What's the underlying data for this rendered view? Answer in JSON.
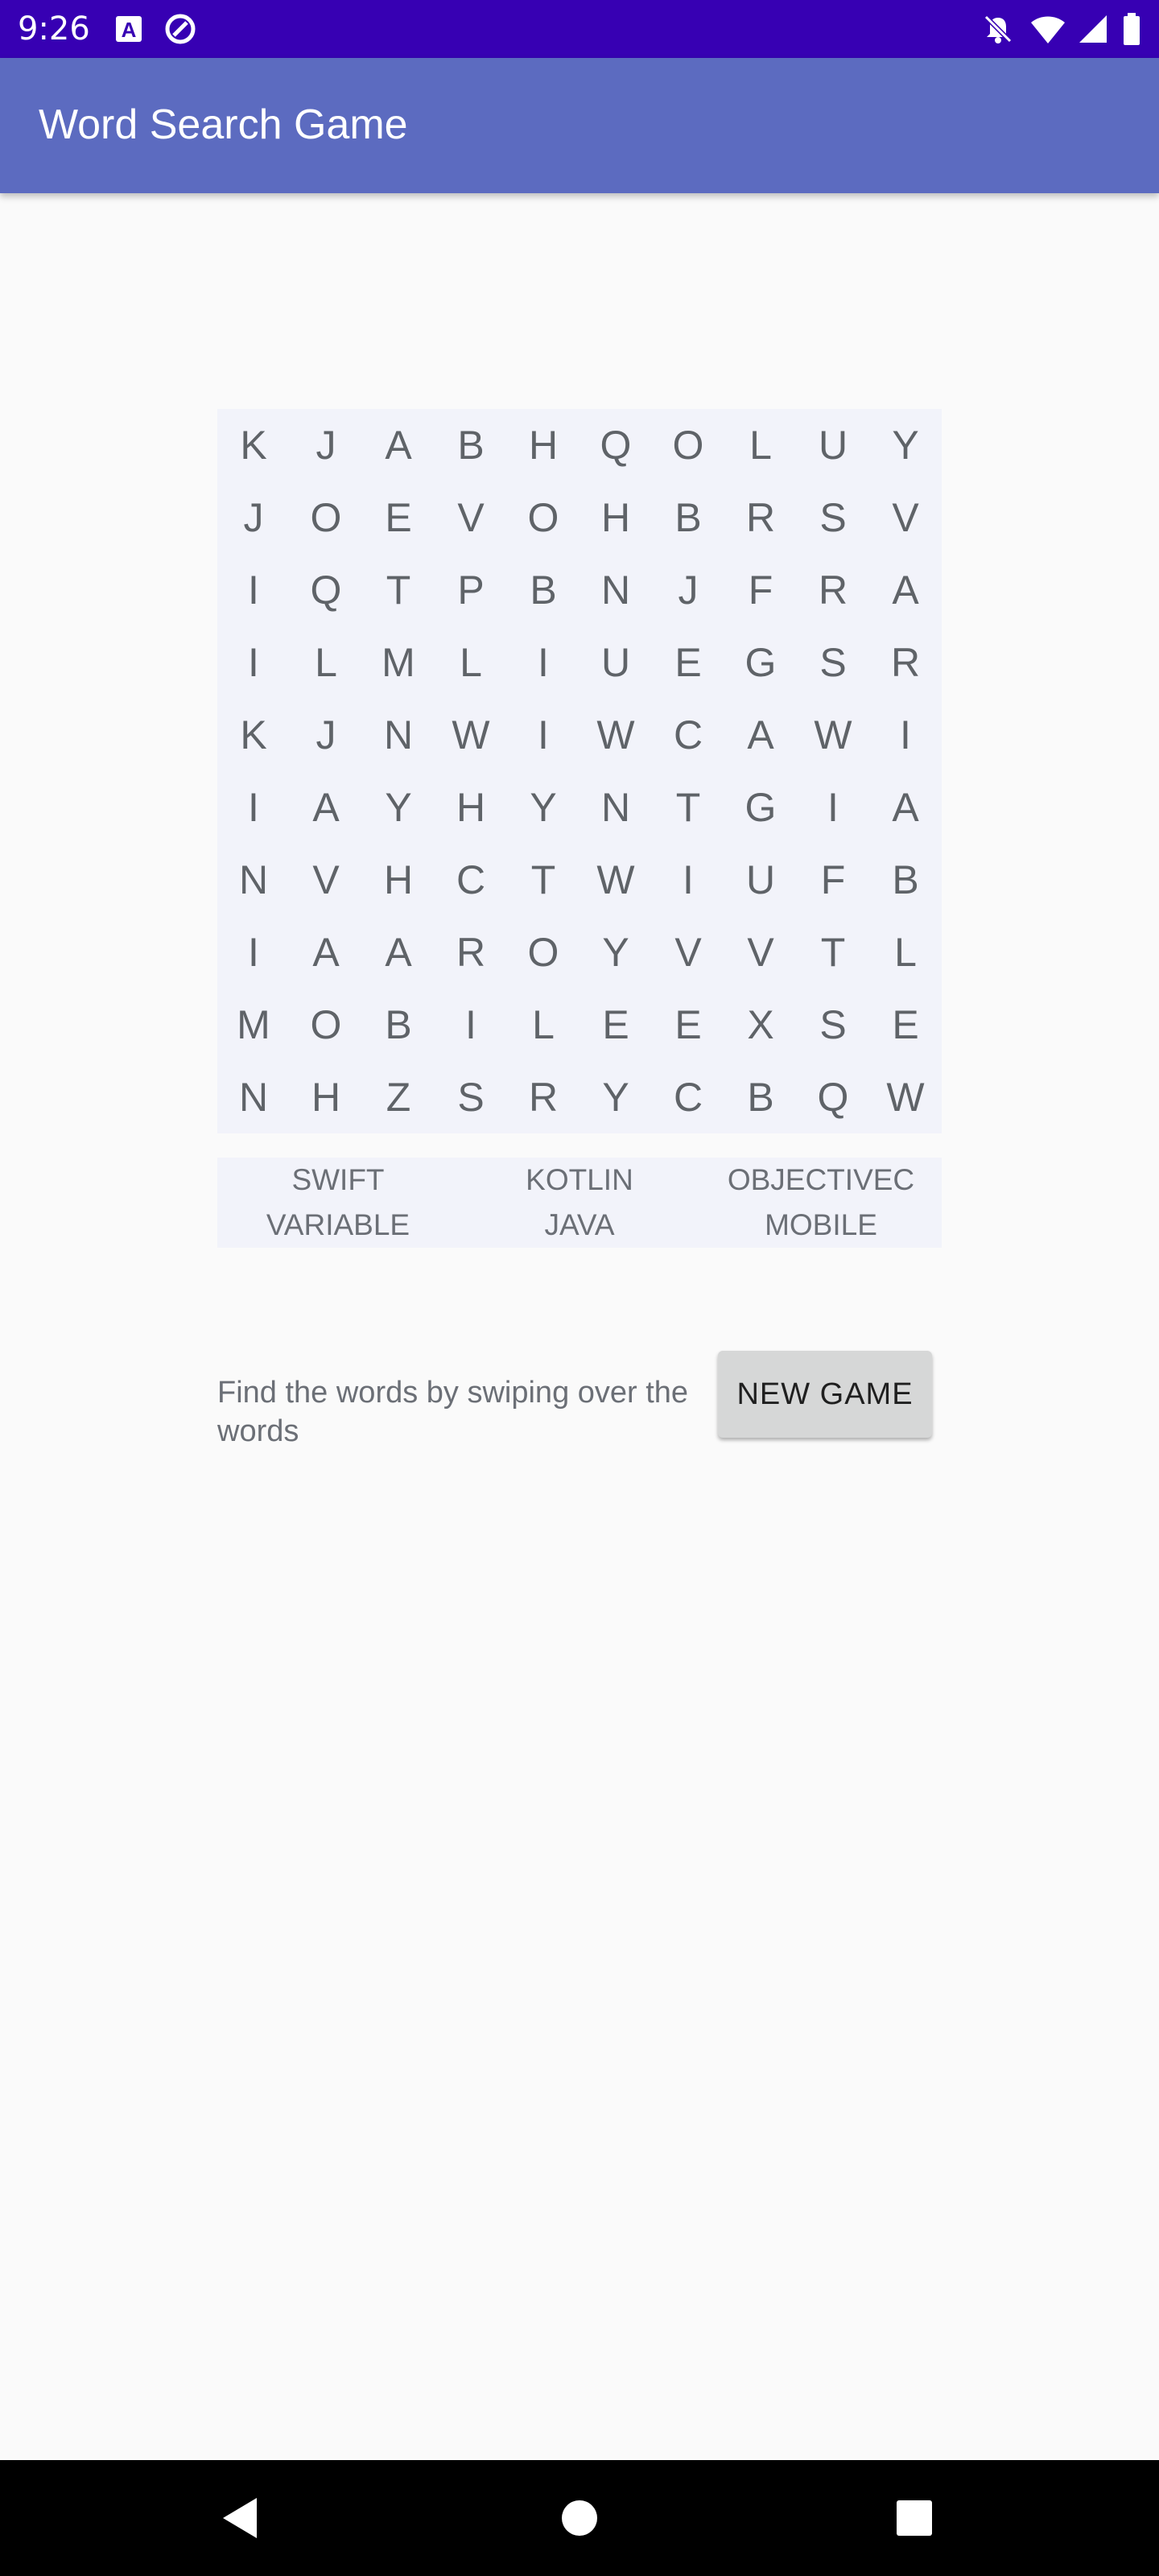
{
  "status_bar": {
    "time": "9:26",
    "left_icons": [
      "text-a-icon",
      "at-sign-icon"
    ],
    "right_icons": [
      "notifications-off-icon",
      "wifi-icon",
      "cell-signal-icon",
      "battery-icon"
    ]
  },
  "app_bar": {
    "title": "Word Search Game",
    "color": "#5c6bc0"
  },
  "grid": {
    "rows": [
      [
        "K",
        "J",
        "A",
        "B",
        "H",
        "Q",
        "O",
        "L",
        "U",
        "Y"
      ],
      [
        "J",
        "O",
        "E",
        "V",
        "O",
        "H",
        "B",
        "R",
        "S",
        "V"
      ],
      [
        "I",
        "Q",
        "T",
        "P",
        "B",
        "N",
        "J",
        "F",
        "R",
        "A"
      ],
      [
        "I",
        "L",
        "M",
        "L",
        "I",
        "U",
        "E",
        "G",
        "S",
        "R"
      ],
      [
        "K",
        "J",
        "N",
        "W",
        "I",
        "W",
        "C",
        "A",
        "W",
        "I"
      ],
      [
        "I",
        "A",
        "Y",
        "H",
        "Y",
        "N",
        "T",
        "G",
        "I",
        "A"
      ],
      [
        "N",
        "V",
        "H",
        "C",
        "T",
        "W",
        "I",
        "U",
        "F",
        "B"
      ],
      [
        "I",
        "A",
        "A",
        "R",
        "O",
        "Y",
        "V",
        "V",
        "T",
        "L"
      ],
      [
        "M",
        "O",
        "B",
        "I",
        "L",
        "E",
        "E",
        "X",
        "S",
        "E"
      ],
      [
        "N",
        "H",
        "Z",
        "S",
        "R",
        "Y",
        "C",
        "B",
        "Q",
        "W"
      ]
    ]
  },
  "words": [
    "SWIFT",
    "KOTLIN",
    "OBJECTIVEC",
    "VARIABLE",
    "JAVA",
    "MOBILE"
  ],
  "hint": "Find the words by swiping over the words",
  "new_game_label": "NEW GAME",
  "nav_bar": {
    "icons": [
      "back-icon",
      "home-icon",
      "recents-icon"
    ]
  }
}
